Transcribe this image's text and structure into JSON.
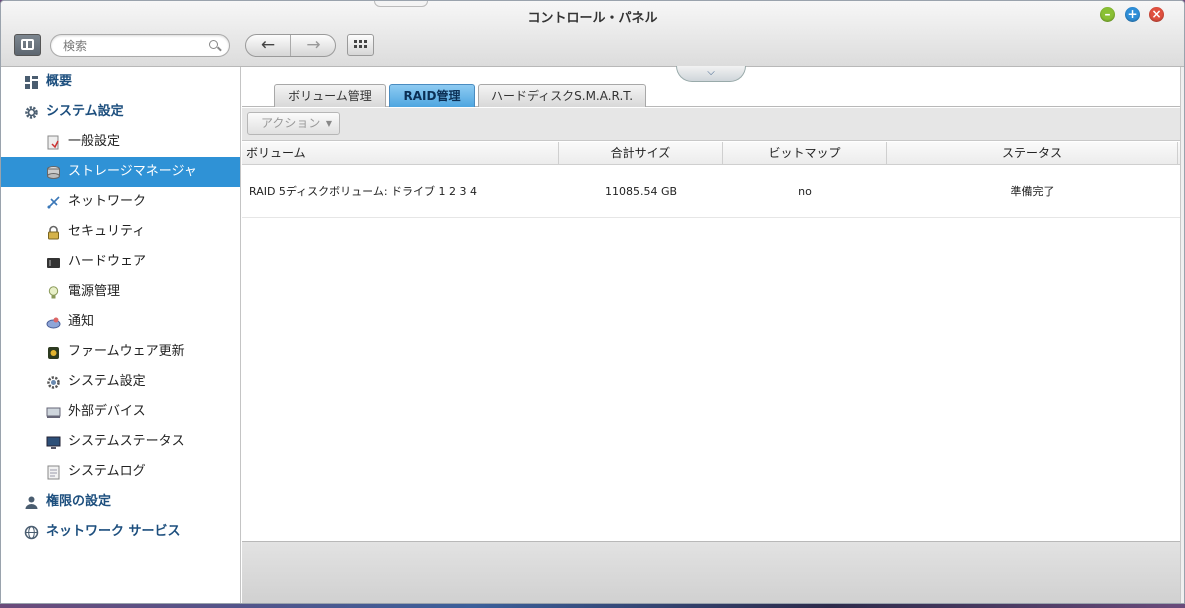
{
  "window": {
    "title": "コントロール・パネル"
  },
  "toolbar": {
    "search_placeholder": "検索",
    "back_icon": "←",
    "forward_icon": "→"
  },
  "sidebar": {
    "items": [
      {
        "label": "概要",
        "icon": "overview-icon"
      },
      {
        "label": "システム設定",
        "icon": "gear-icon"
      },
      {
        "label": "一般設定",
        "icon": "general-settings-icon"
      },
      {
        "label": "ストレージマネージャ",
        "icon": "storage-icon"
      },
      {
        "label": "ネットワーク",
        "icon": "network-icon"
      },
      {
        "label": "セキュリティ",
        "icon": "lock-icon"
      },
      {
        "label": "ハードウェア",
        "icon": "hardware-icon"
      },
      {
        "label": "電源管理",
        "icon": "lightbulb-icon"
      },
      {
        "label": "通知",
        "icon": "notification-icon"
      },
      {
        "label": "ファームウェア更新",
        "icon": "firmware-icon"
      },
      {
        "label": "システム設定",
        "icon": "system-settings-icon"
      },
      {
        "label": "外部デバイス",
        "icon": "external-device-icon"
      },
      {
        "label": "システムステータス",
        "icon": "monitor-icon"
      },
      {
        "label": "システムログ",
        "icon": "log-icon"
      },
      {
        "label": "権限の設定",
        "icon": "user-icon"
      },
      {
        "label": "ネットワーク サービス",
        "icon": "globe-icon"
      }
    ]
  },
  "tabs": [
    {
      "label": "ボリューム管理",
      "active": false
    },
    {
      "label": "RAID管理",
      "active": true
    },
    {
      "label": "ハードディスクS.M.A.R.T.",
      "active": false
    }
  ],
  "action": {
    "label": "アクション"
  },
  "table": {
    "columns": [
      "ボリューム",
      "合計サイズ",
      "ビットマップ",
      "ステータス"
    ],
    "rows": [
      {
        "volume": "RAID 5ディスクボリューム: ドライブ 1 2 3 4",
        "total_size": "11085.54 GB",
        "bitmap": "no",
        "status": "準備完了"
      }
    ]
  },
  "colors": {
    "accent": "#2f92d6",
    "nav_heading": "#1d4f7e"
  }
}
